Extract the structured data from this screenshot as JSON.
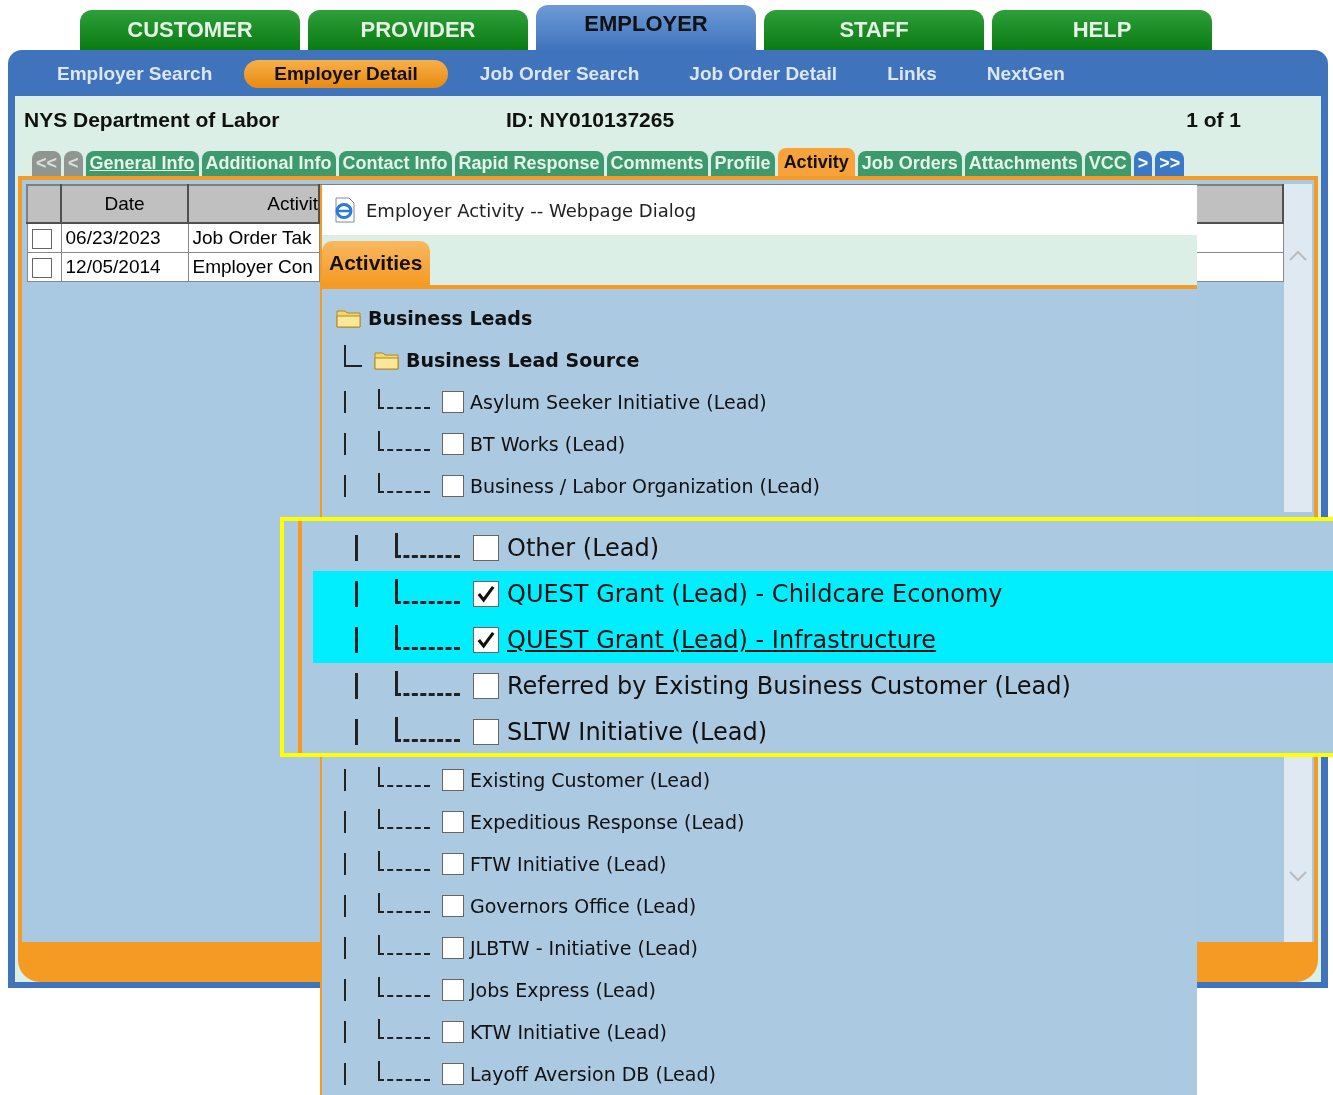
{
  "main_tabs": [
    {
      "label": "CUSTOMER",
      "selected": false
    },
    {
      "label": "PROVIDER",
      "selected": false
    },
    {
      "label": "EMPLOYER",
      "selected": true
    },
    {
      "label": "STAFF",
      "selected": false
    },
    {
      "label": "HELP",
      "selected": false
    }
  ],
  "nav_links": [
    {
      "label": "Employer Search",
      "selected": false
    },
    {
      "label": "Employer Detail",
      "selected": true
    },
    {
      "label": "Job Order Search",
      "selected": false
    },
    {
      "label": "Job Order Detail",
      "selected": false
    },
    {
      "label": "Links",
      "selected": false
    },
    {
      "label": "NextGen",
      "selected": false
    }
  ],
  "header": {
    "name": "NYS Department of Labor",
    "id": "ID: NY010137265",
    "count": "1 of 1"
  },
  "detail_tabs": {
    "prev": [
      "<<",
      "<"
    ],
    "tabs": [
      {
        "label": "General Info",
        "selected": false,
        "underlined": true
      },
      {
        "label": "Additional Info",
        "selected": false,
        "underlined": false
      },
      {
        "label": "Contact Info",
        "selected": false,
        "underlined": false
      },
      {
        "label": "Rapid Response",
        "selected": false,
        "underlined": false
      },
      {
        "label": "Comments",
        "selected": false,
        "underlined": false
      },
      {
        "label": "Profile",
        "selected": false,
        "underlined": false
      },
      {
        "label": "Activity",
        "selected": true,
        "underlined": false
      },
      {
        "label": "Job Orders",
        "selected": false,
        "underlined": false
      },
      {
        "label": "Attachments",
        "selected": false,
        "underlined": false
      },
      {
        "label": "VCC",
        "selected": false,
        "underlined": false
      }
    ],
    "next": [
      ">",
      ">>"
    ]
  },
  "activity_table": {
    "columns": [
      "Date",
      "Activit"
    ],
    "rows": [
      {
        "checked": false,
        "date": "06/23/2023",
        "activity": "Job Order Tak"
      },
      {
        "checked": false,
        "date": "12/05/2014",
        "activity": "Employer Con"
      }
    ]
  },
  "dialog": {
    "title": "Employer Activity -- Webpage Dialog",
    "tab": "Activities",
    "tree": {
      "label": "Business Leads",
      "children": [
        {
          "label": "Business Lead Source",
          "children_before": [
            {
              "label": "Asylum Seeker Initiative (Lead)",
              "checked": false
            },
            {
              "label": "BT Works (Lead)",
              "checked": false
            },
            {
              "label": "Business / Labor Organization (Lead)",
              "checked": false
            }
          ],
          "children_after": [
            {
              "label": "Existing Customer (Lead)",
              "checked": false
            },
            {
              "label": "Expeditious Response (Lead)",
              "checked": false
            },
            {
              "label": "FTW Initiative (Lead)",
              "checked": false
            },
            {
              "label": "Governors Office (Lead)",
              "checked": false
            },
            {
              "label": "JLBTW - Initiative (Lead)",
              "checked": false
            },
            {
              "label": "Jobs Express (Lead)",
              "checked": false
            },
            {
              "label": "KTW Initiative (Lead)",
              "checked": false
            },
            {
              "label": "Layoff Aversion DB (Lead)",
              "checked": false
            }
          ]
        }
      ]
    }
  },
  "callout": {
    "items": [
      {
        "label": "Other (Lead)",
        "checked": false,
        "selected": false,
        "underlined": false
      },
      {
        "label": "QUEST Grant (Lead) - Childcare Economy",
        "checked": true,
        "selected": true,
        "underlined": false
      },
      {
        "label": "QUEST Grant (Lead) - Infrastructure",
        "checked": true,
        "selected": true,
        "underlined": true
      },
      {
        "label": "Referred by Existing Business Customer (Lead)",
        "checked": false,
        "selected": false,
        "underlined": false
      },
      {
        "label": "SLTW Initiative (Lead)",
        "checked": false,
        "selected": false,
        "underlined": false
      }
    ]
  }
}
